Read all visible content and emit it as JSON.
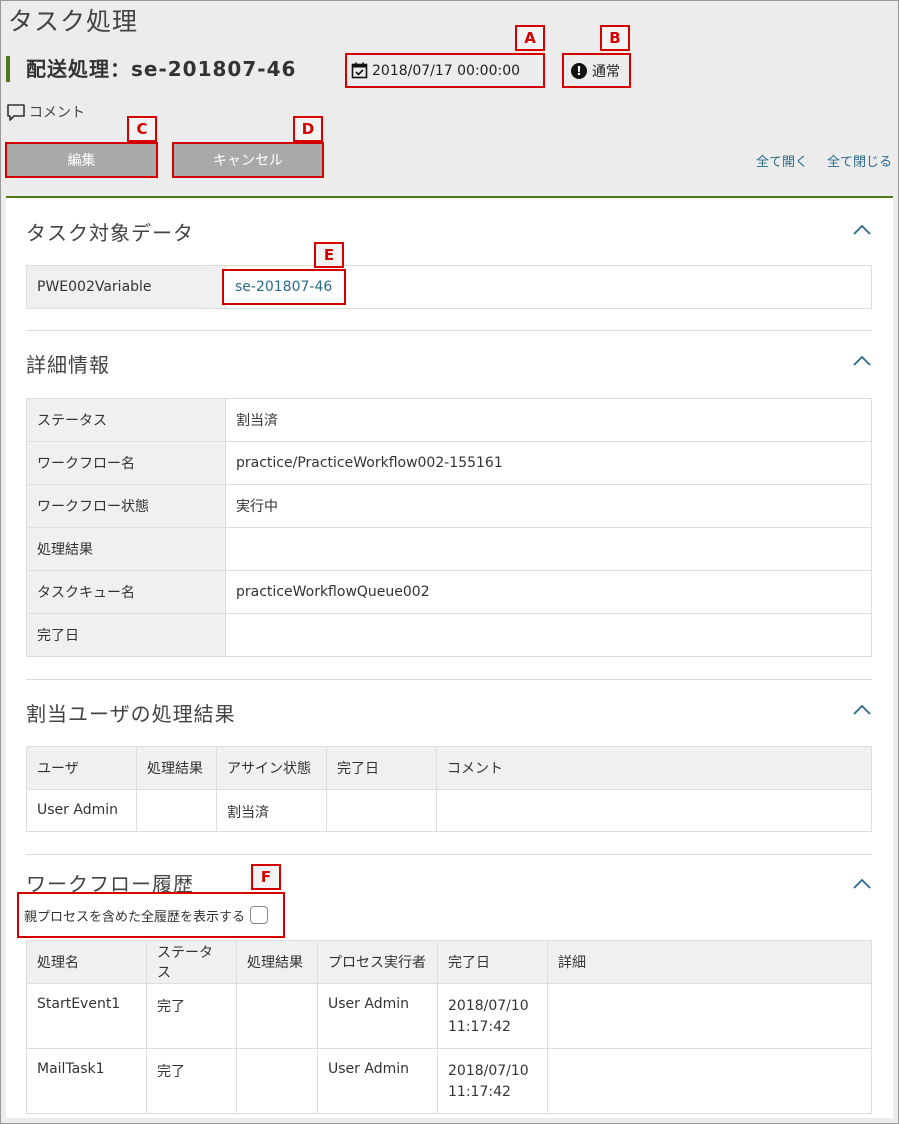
{
  "page": {
    "title": "タスク処理"
  },
  "task": {
    "title": "配送処理：se-201807-46",
    "date": "2018/07/17 00:00:00",
    "priority": "通常"
  },
  "callouts": {
    "a": "A",
    "b": "B",
    "c": "C",
    "d": "D",
    "e": "E",
    "f": "F"
  },
  "actions": {
    "comment_label": "コメント",
    "edit_label": "編集",
    "cancel_label": "キャンセル",
    "expand_all": "全て開く",
    "collapse_all": "全て閉じる"
  },
  "target_data": {
    "title": "タスク対象データ",
    "key": "PWE002Variable",
    "value": "se-201807-46"
  },
  "details": {
    "title": "詳細情報",
    "rows": [
      {
        "key": "ステータス",
        "value": "割当済"
      },
      {
        "key": "ワークフロー名",
        "value": "practice/PracticeWorkflow002-155161"
      },
      {
        "key": "ワークフロー状態",
        "value": "実行中"
      },
      {
        "key": "処理結果",
        "value": ""
      },
      {
        "key": "タスクキュー名",
        "value": "practiceWorkflowQueue002"
      },
      {
        "key": "完了日",
        "value": ""
      }
    ]
  },
  "assigned": {
    "title": "割当ユーザの処理結果",
    "headers": [
      "ユーザ",
      "処理結果",
      "アサイン状態",
      "完了日",
      "コメント"
    ],
    "rows": [
      [
        "User Admin",
        "",
        "割当済",
        "",
        ""
      ]
    ]
  },
  "history": {
    "title": "ワークフロー履歴",
    "checkbox_label": "親プロセスを含めた全履歴を表示する",
    "headers": [
      "処理名",
      "ステータス",
      "処理結果",
      "プロセス実行者",
      "完了日",
      "詳細"
    ],
    "rows": [
      {
        "name": "StartEvent1",
        "status": "完了",
        "result": "",
        "actor": "User Admin",
        "date": "2018/07/10",
        "time": "11:17:42",
        "detail": ""
      },
      {
        "name": "MailTask1",
        "status": "完了",
        "result": "",
        "actor": "User Admin",
        "date": "2018/07/10",
        "time": "11:17:42",
        "detail": ""
      }
    ]
  },
  "colors": {
    "accent_green": "#4e7a1c",
    "callout_red": "#d40000",
    "link": "#2a6a8a"
  }
}
